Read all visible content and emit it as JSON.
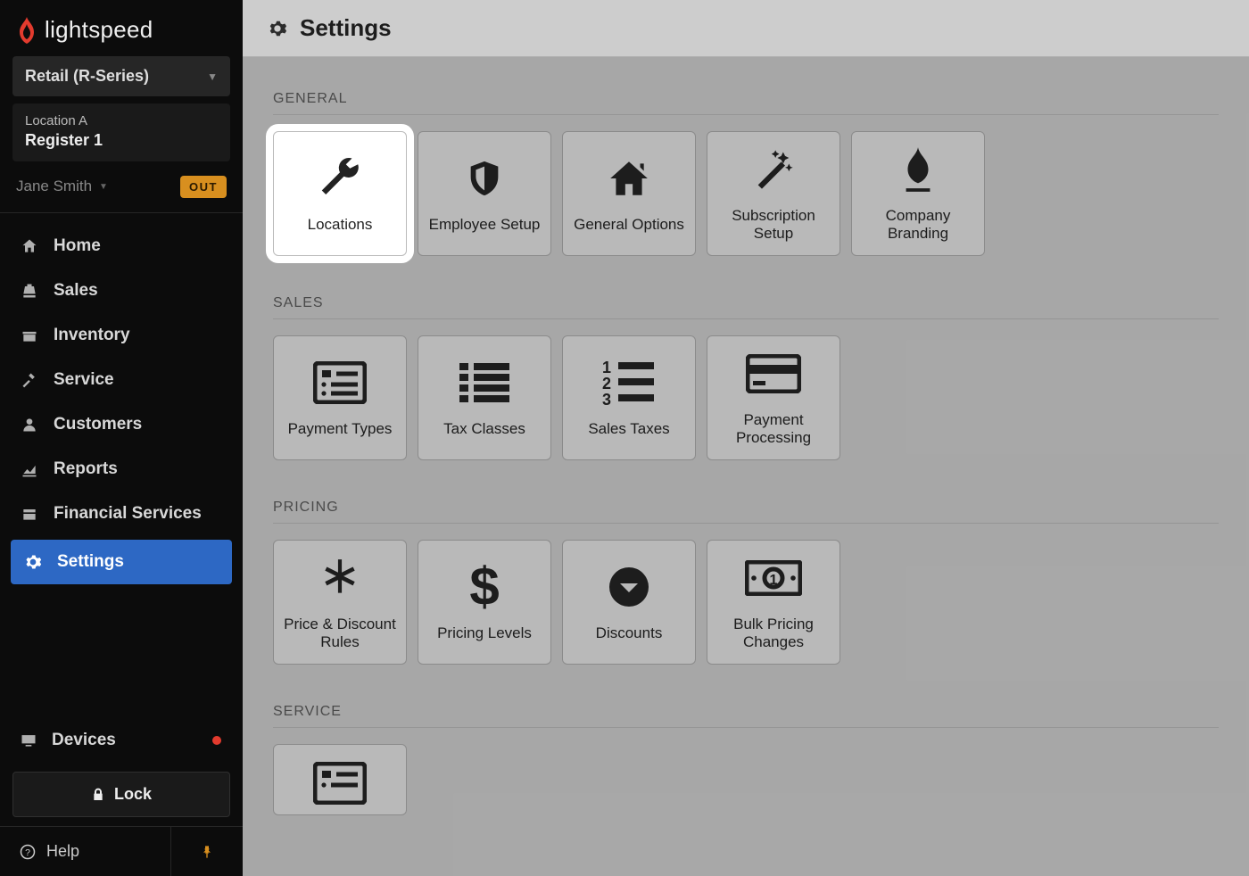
{
  "brand": "lightspeed",
  "product_selector": "Retail (R-Series)",
  "location": "Location A",
  "register": "Register 1",
  "user": "Jane Smith",
  "out_badge": "OUT",
  "nav": {
    "home": "Home",
    "sales": "Sales",
    "inventory": "Inventory",
    "service": "Service",
    "customers": "Customers",
    "reports": "Reports",
    "financial": "Financial Services",
    "settings": "Settings"
  },
  "devices": "Devices",
  "lock": "Lock",
  "help": "Help",
  "page_title": "Settings",
  "sections": {
    "general": {
      "title": "GENERAL",
      "tiles": {
        "locations": "Locations",
        "employee_setup": "Employee Setup",
        "general_options": "General Options",
        "subscription_setup": "Subscription Setup",
        "company_branding": "Company Branding"
      }
    },
    "sales": {
      "title": "SALES",
      "tiles": {
        "payment_types": "Payment Types",
        "tax_classes": "Tax Classes",
        "sales_taxes": "Sales Taxes",
        "payment_processing": "Payment Processing"
      }
    },
    "pricing": {
      "title": "PRICING",
      "tiles": {
        "price_discount_rules": "Price & Discount Rules",
        "pricing_levels": "Pricing Levels",
        "discounts": "Discounts",
        "bulk_pricing_changes": "Bulk Pricing Changes"
      }
    },
    "service": {
      "title": "SERVICE"
    }
  }
}
